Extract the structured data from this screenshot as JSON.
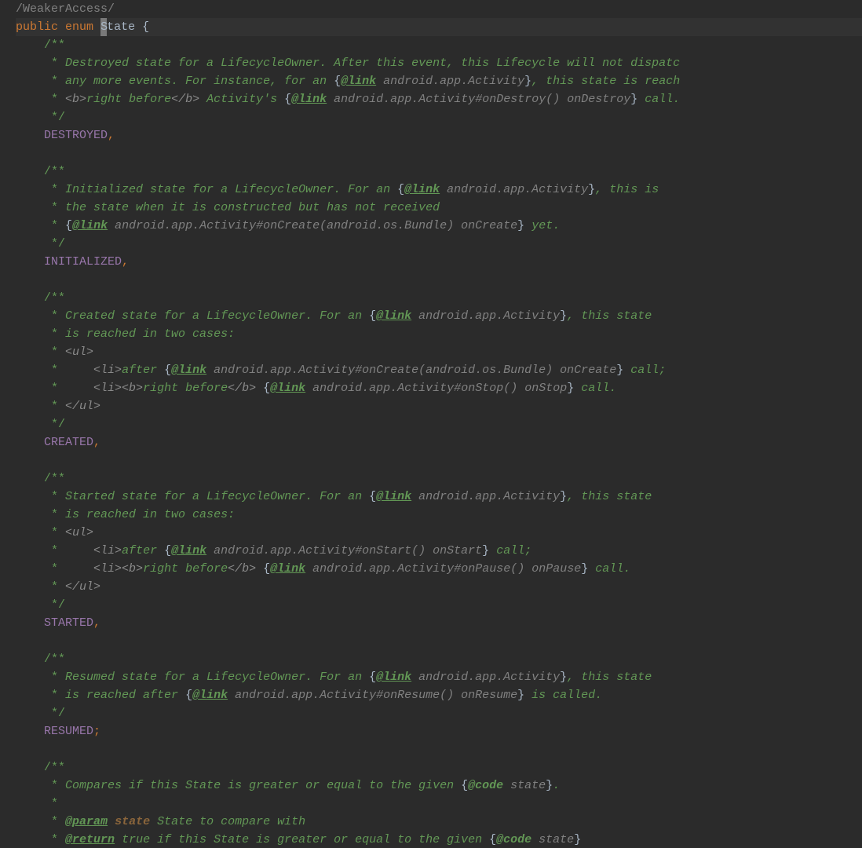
{
  "suppress": "/WeakerAccess/",
  "decl": {
    "pub": "public",
    "enum": "enum",
    "name": "tate",
    "curChar": "S",
    "brace": " {"
  },
  "destroyed": {
    "open": "/**",
    "l1a": " * Destroyed state for a LifecycleOwner. After this event, this Lifecycle will not dispatc",
    "l2a": " * any more events. For instance, for an ",
    "l2b": "{",
    "l2c": "@link",
    "l2d": " android.app.Activity",
    "l2e": "}",
    "l2f": ", this state is reach",
    "l3a": " * ",
    "l3b": "<b>",
    "l3c": "right before",
    "l3d": "</b>",
    "l3e": " Activity's ",
    "l3f": "{",
    "l3g": "@link",
    "l3h": " android.app.Activity#onDestroy() onDestroy",
    "l3i": "}",
    "l3j": " call.",
    "close": " */",
    "name": "DESTROYED",
    "comma": ","
  },
  "initialized": {
    "open": "/**",
    "l1a": " * Initialized state for a LifecycleOwner. For an ",
    "l1b": "{",
    "l1c": "@link",
    "l1d": " android.app.Activity",
    "l1e": "}",
    "l1f": ", this is",
    "l2a": " * the state when it is constructed but has not received",
    "l3a": " * ",
    "l3b": "{",
    "l3c": "@link",
    "l3d": " android.app.Activity#onCreate(android.os.Bundle) onCreate",
    "l3e": "}",
    "l3f": " yet.",
    "close": " */",
    "name": "INITIALIZED",
    "comma": ","
  },
  "created": {
    "open": "/**",
    "l1a": " * Created state for a LifecycleOwner. For an ",
    "l1b": "{",
    "l1c": "@link",
    "l1d": " android.app.Activity",
    "l1e": "}",
    "l1f": ", this state",
    "l2a": " * is reached in two cases:",
    "l3a": " * ",
    "l3b": "<ul>",
    "l4a": " *     ",
    "l4b": "<li>",
    "l4c": "after ",
    "l4d": "{",
    "l4e": "@link",
    "l4f": " android.app.Activity#onCreate(android.os.Bundle) onCreate",
    "l4g": "}",
    "l4h": " call;",
    "l5a": " *     ",
    "l5b": "<li><b>",
    "l5c": "right before",
    "l5d": "</b>",
    "l5e": " ",
    "l5f": "{",
    "l5g": "@link",
    "l5h": " android.app.Activity#onStop() onStop",
    "l5i": "}",
    "l5j": " call.",
    "l6a": " * ",
    "l6b": "</ul>",
    "close": " */",
    "name": "CREATED",
    "comma": ","
  },
  "started": {
    "open": "/**",
    "l1a": " * Started state for a LifecycleOwner. For an ",
    "l1b": "{",
    "l1c": "@link",
    "l1d": " android.app.Activity",
    "l1e": "}",
    "l1f": ", this state",
    "l2a": " * is reached in two cases:",
    "l3a": " * ",
    "l3b": "<ul>",
    "l4a": " *     ",
    "l4b": "<li>",
    "l4c": "after ",
    "l4d": "{",
    "l4e": "@link",
    "l4f": " android.app.Activity#onStart() onStart",
    "l4g": "}",
    "l4h": " call;",
    "l5a": " *     ",
    "l5b": "<li><b>",
    "l5c": "right before",
    "l5d": "</b>",
    "l5e": " ",
    "l5f": "{",
    "l5g": "@link",
    "l5h": " android.app.Activity#onPause() onPause",
    "l5i": "}",
    "l5j": " call.",
    "l6a": " * ",
    "l6b": "</ul>",
    "close": " */",
    "name": "STARTED",
    "comma": ","
  },
  "resumed": {
    "open": "/**",
    "l1a": " * Resumed state for a LifecycleOwner. For an ",
    "l1b": "{",
    "l1c": "@link",
    "l1d": " android.app.Activity",
    "l1e": "}",
    "l1f": ", this state",
    "l2a": " * is reached after ",
    "l2b": "{",
    "l2c": "@link",
    "l2d": " android.app.Activity#onResume() onResume",
    "l2e": "}",
    "l2f": " is called.",
    "close": " */",
    "name": "RESUMED",
    "semi": ";"
  },
  "method": {
    "open": "/**",
    "l1a": " * Compares if this State is greater or equal to the given ",
    "l1b": "{",
    "l1c": "@code",
    "l1d": " state",
    "l1e": "}",
    "l1f": ".",
    "blank": " *",
    "l3a": " * ",
    "l3b": "@param",
    "l3c": " ",
    "l3d": "state",
    "l3e": " State to compare with",
    "l4a": " * ",
    "l4b": "@return",
    "l4c": " true if this State is greater or equal to the given ",
    "l4d": "{",
    "l4e": "@code",
    "l4f": " state",
    "l4g": "}"
  },
  "pad4": "    ",
  "pad8": "        "
}
